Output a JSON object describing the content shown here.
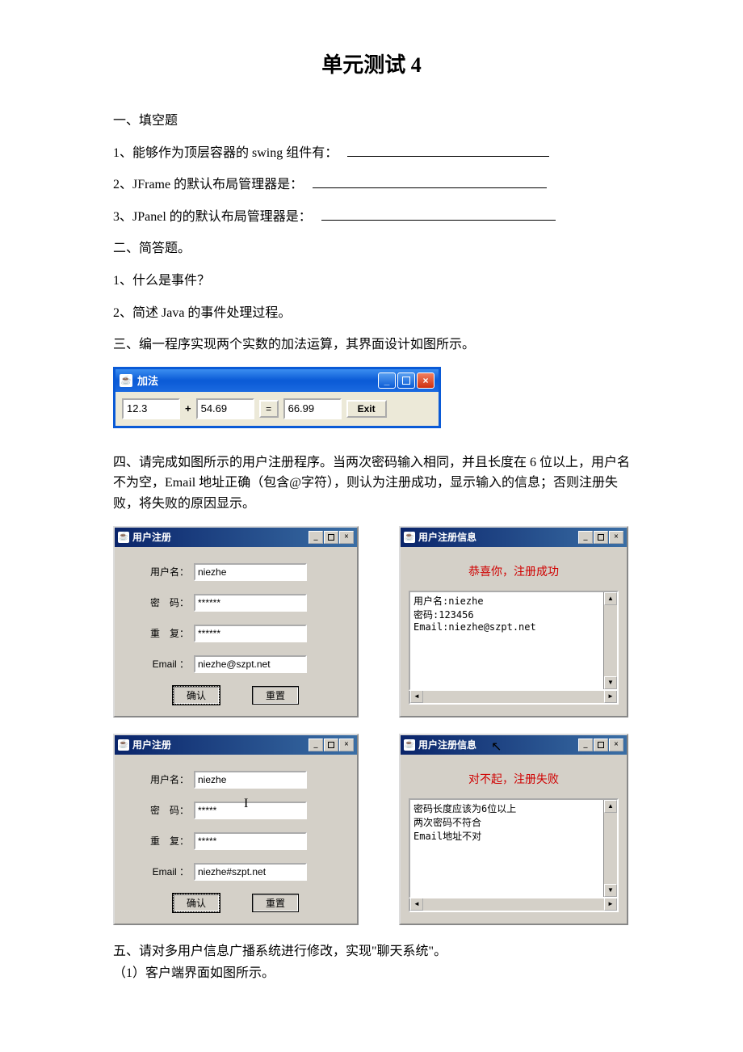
{
  "title": "单元测试 4",
  "sec1_heading": "一、填空题",
  "q1": "1、能够作为顶层容器的 swing 组件有：",
  "q2": "2、JFrame 的默认布局管理器是：",
  "q3": "3、JPanel 的的默认布局管理器是：",
  "sec2_heading": "二、简答题。",
  "q2_1": "1、什么是事件？",
  "q2_2": "2、简述 Java 的事件处理过程。",
  "sec3_heading": "三、编一程序实现两个实数的加法运算，其界面设计如图所示。",
  "add_window": {
    "title": "加法",
    "val1": "12.3",
    "plus": "+",
    "val2": "54.69",
    "eq": "=",
    "result": "66.99",
    "exit": "Exit"
  },
  "sec4_heading": "四、请完成如图所示的用户注册程序。当两次密码输入相同，并且长度在 6 位以上，用户名不为空，Email 地址正确（包含@字符），则认为注册成功，显示输入的信息；否则注册失败，将失败的原因显示。",
  "reg_window": {
    "title": "用户注册",
    "username_label": "用户名：",
    "password_label": "密　码：",
    "repeat_label": "重　复：",
    "email_label": "Email ：",
    "ok_btn": "确认",
    "reset_btn": "重置"
  },
  "reg_success": {
    "username": "niezhe",
    "password": "******",
    "repeat": "******",
    "email": "niezhe@szpt.net"
  },
  "reg_fail": {
    "username": "niezhe",
    "password": "*****",
    "repeat": "*****",
    "email": "niezhe#szpt.net"
  },
  "info_window_title": "用户注册信息",
  "info_success": {
    "msg": "恭喜你，注册成功",
    "body": "用户名:niezhe\n密码:123456\nEmail:niezhe@szpt.net"
  },
  "info_fail": {
    "msg": "对不起，注册失败",
    "body": "密码长度应该为6位以上\n两次密码不符合\nEmail地址不对"
  },
  "sec5_heading": "五、请对多用户信息广播系统进行修改，实现\"聊天系统\"。",
  "sec5_sub1": "（1）客户端界面如图所示。"
}
